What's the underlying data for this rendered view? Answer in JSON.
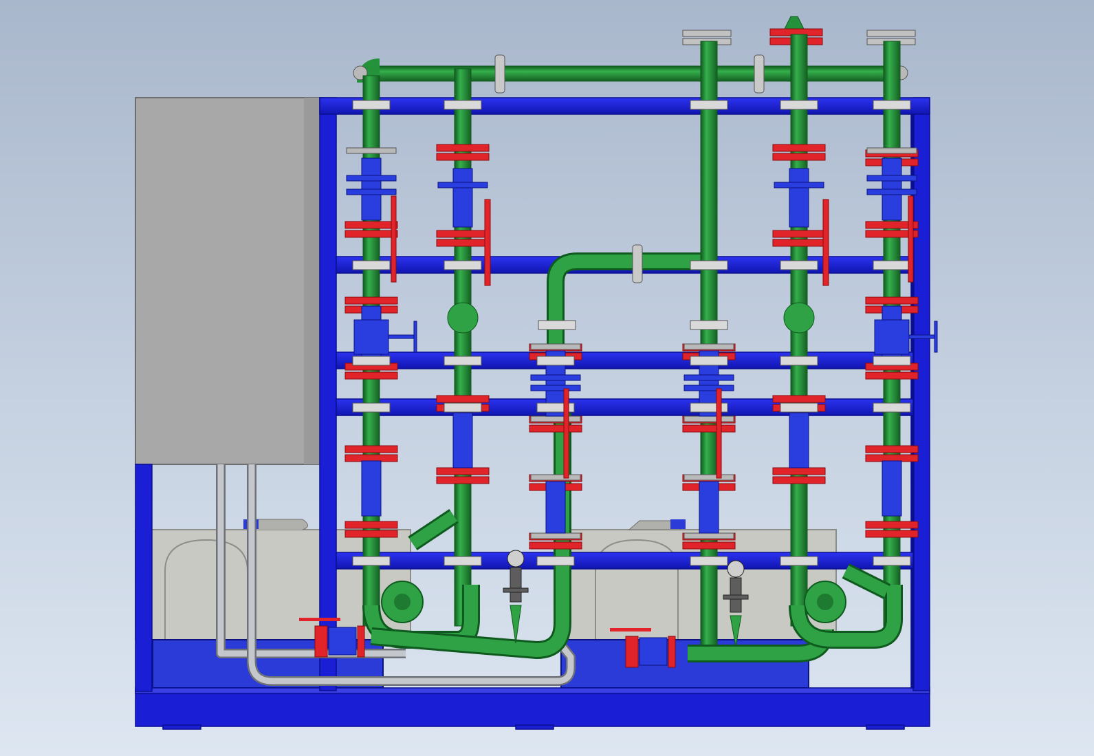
{
  "colors": {
    "frame": "#1a1fd6",
    "frame_edge": "#0b0f8f",
    "pipe": "#23923a",
    "pipe_edge": "#0f5a1e",
    "flange": "#e0242a",
    "flange_edge": "#8a0a0e",
    "valve": "#2a3ee0",
    "valve_edge": "#0a1380",
    "gray_flange": "#b9b9b9",
    "cabinet": "#a9a9a9",
    "pump_body": "#c9c9c4",
    "pump_base": "#2b3bd8",
    "tube": "#b5b8bd"
  },
  "icons": {
    "cabinet": "control-cabinet-icon",
    "pump": "pump-unit-icon",
    "gauge": "pressure-gauge-icon"
  }
}
